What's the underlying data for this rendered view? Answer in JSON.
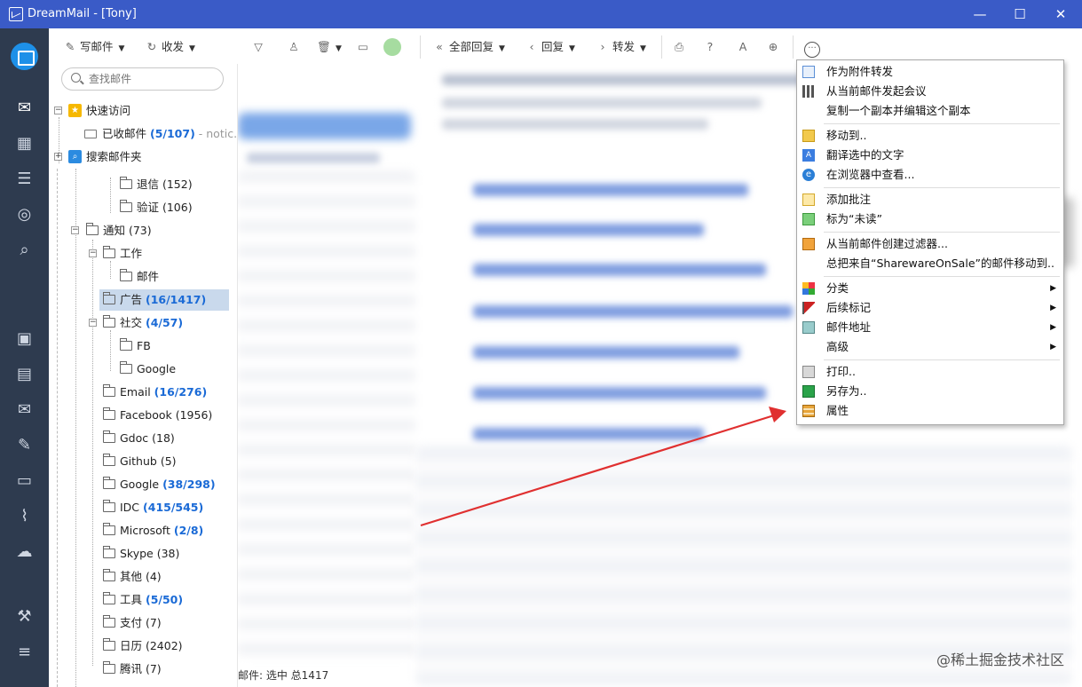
{
  "window": {
    "title": "DreamMail - [Tony]",
    "minimize": "—",
    "maximize": "☐",
    "close": "✕"
  },
  "toolbar": {
    "compose": "写邮件",
    "send_receive": "收发",
    "reply_all": "全部回复",
    "reply": "回复",
    "forward": "转发"
  },
  "search": {
    "placeholder": "查找邮件"
  },
  "tree": {
    "quick_access": "快速访问",
    "inbox": "已收邮件",
    "inbox_count": "(5/107)",
    "inbox_note": "- notic...",
    "search_folder": "搜索邮件夹",
    "bounce": "退信 (152)",
    "verify": "验证 (106)",
    "notify": "通知 (73)",
    "work": "工作",
    "mail": "邮件",
    "ads": "广告",
    "ads_count": "(16/1417)",
    "social": "社交",
    "social_count": "(4/57)",
    "fb": "FB",
    "google_sub": "Google",
    "email": "Email",
    "email_count": "(16/276)",
    "facebook": "Facebook (1956)",
    "gdoc": "Gdoc (18)",
    "github": "Github (5)",
    "google": "Google",
    "google_count": "(38/298)",
    "idc": "IDC",
    "idc_count": "(415/545)",
    "microsoft": "Microsoft",
    "microsoft_count": "(2/8)",
    "skype": "Skype (38)",
    "other": "其他 (4)",
    "tools": "工具",
    "tools_count": "(5/50)",
    "pay": "支付 (7)",
    "calendar": "日历 (2402)",
    "tencent": "腾讯 (7)"
  },
  "context_menu": [
    {
      "label": "作为附件转发",
      "icon": "forward-attachment-icon"
    },
    {
      "label": "从当前邮件发起会议",
      "icon": "meeting-icon"
    },
    {
      "label": "复制一个副本并编辑这个副本",
      "icon": ""
    },
    {
      "label": "移动到..",
      "icon": "move-icon"
    },
    {
      "label": "翻译选中的文字",
      "icon": "translate-icon"
    },
    {
      "label": "在浏览器中查看...",
      "icon": "browser-icon"
    },
    {
      "label": "添加批注",
      "icon": "note-icon"
    },
    {
      "label": "标为“未读”",
      "icon": "mark-unread-icon"
    },
    {
      "label": "从当前邮件创建过滤器...",
      "icon": "filter-icon"
    },
    {
      "label": "总把来自“SharewareOnSale”的邮件移动到..",
      "icon": ""
    },
    {
      "label": "分类",
      "icon": "category-icon"
    },
    {
      "label": "后续标记",
      "icon": "flag-icon"
    },
    {
      "label": "邮件地址",
      "icon": "address-icon"
    },
    {
      "label": "高级",
      "icon": ""
    },
    {
      "label": "打印..",
      "icon": "print-icon"
    },
    {
      "label": "另存为..",
      "icon": "save-icon"
    },
    {
      "label": "属性",
      "icon": "properties-icon"
    }
  ],
  "status": "邮件: 选中 总1417",
  "watermark": "@稀土掘金技术社区",
  "colors": {
    "titlebar": "#3a5bc7",
    "rail": "#2e3b4f",
    "count": "#1a6ad6",
    "arrow": "#e03030"
  }
}
